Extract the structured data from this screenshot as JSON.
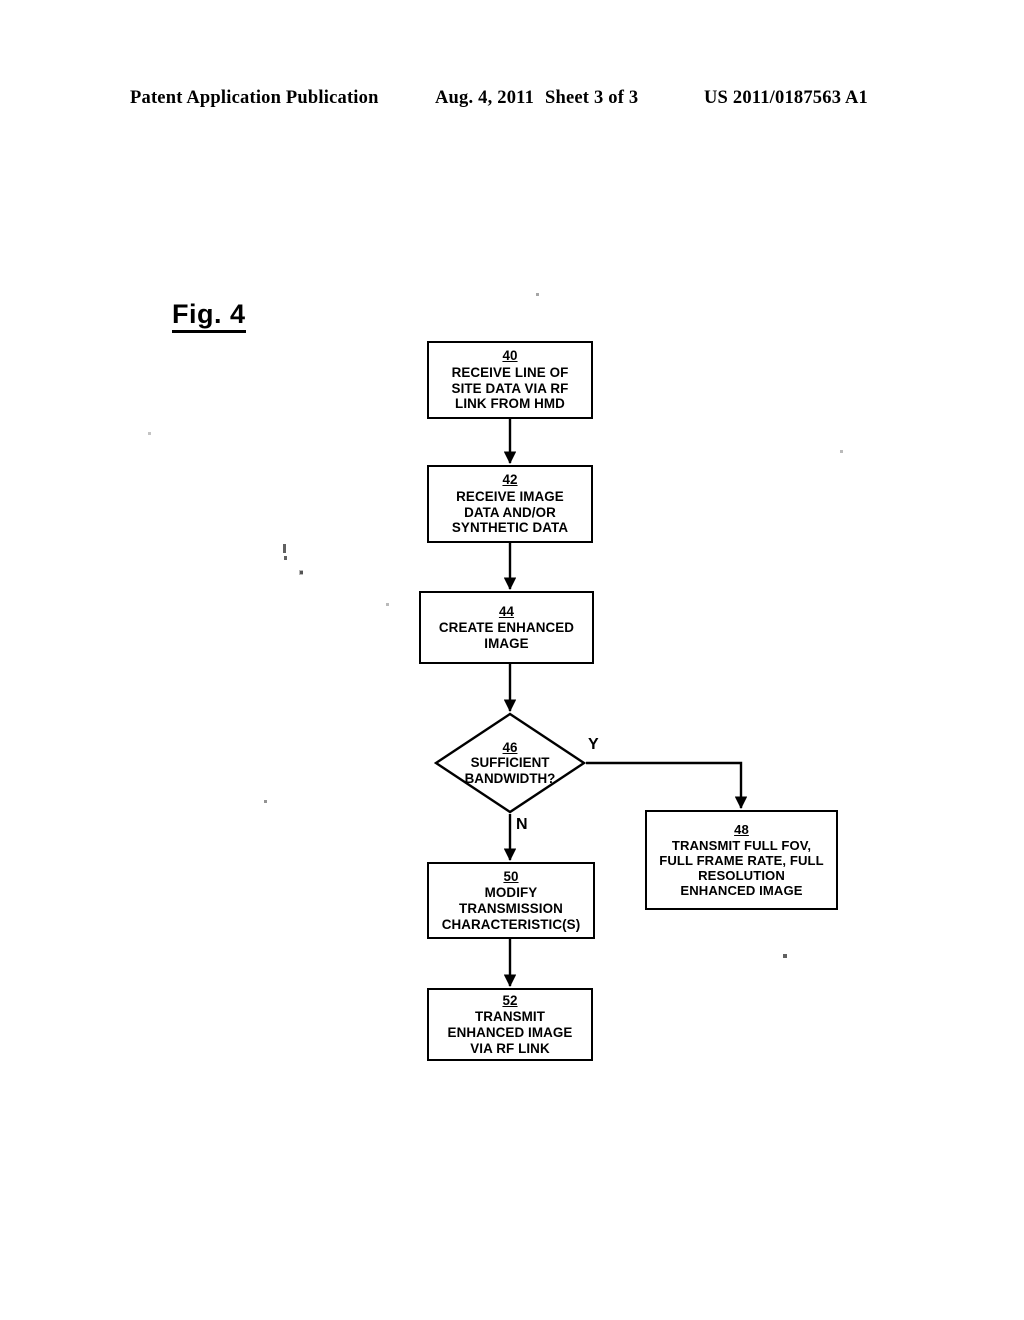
{
  "header": {
    "publication": "Patent Application Publication",
    "date": "Aug. 4, 2011",
    "sheet": "Sheet 3 of 3",
    "patent_number": "US 2011/0187563 A1"
  },
  "figure": {
    "label": "Fig. 4"
  },
  "flowchart": {
    "nodes": [
      {
        "ref": "40",
        "text": "RECEIVE LINE OF\nSITE DATA VIA RF\nLINK FROM HMD",
        "shape": "process"
      },
      {
        "ref": "42",
        "text": "RECEIVE IMAGE\nDATA AND/OR\nSYNTHETIC DATA",
        "shape": "process"
      },
      {
        "ref": "44",
        "text": "CREATE ENHANCED\nIMAGE",
        "shape": "process"
      },
      {
        "ref": "46",
        "text": "SUFFICIENT\nBANDWIDTH?",
        "shape": "decision"
      },
      {
        "ref": "48",
        "text": "TRANSMIT FULL FOV,\nFULL FRAME RATE, FULL\nRESOLUTION\nENHANCED IMAGE",
        "shape": "process"
      },
      {
        "ref": "50",
        "text": "MODIFY\nTRANSMISSION\nCHARACTERISTIC(S)",
        "shape": "process"
      },
      {
        "ref": "52",
        "text": "TRANSMIT\nENHANCED IMAGE\nVIA RF LINK",
        "shape": "process"
      }
    ],
    "branch_labels": {
      "yes": "Y",
      "no": "N"
    },
    "line_color": "#000000"
  }
}
